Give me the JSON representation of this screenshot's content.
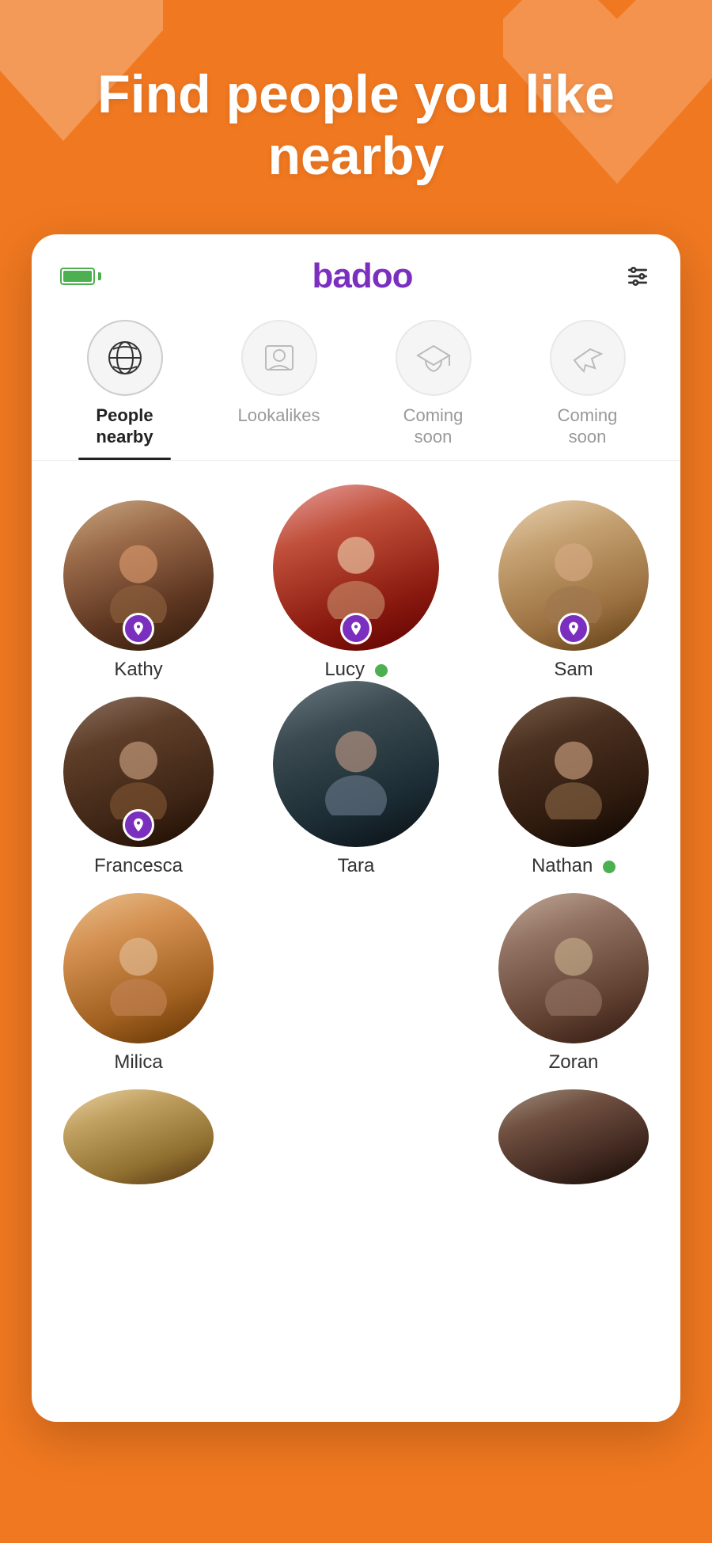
{
  "hero": {
    "title": "Find people you like nearby",
    "background_color": "#F07820"
  },
  "app": {
    "logo": "badoo",
    "accent_color": "#7B2FBE"
  },
  "header": {
    "battery_color": "#4CAF50",
    "filter_label": "filter"
  },
  "tabs": [
    {
      "id": "people-nearby",
      "label": "People\nnearby",
      "icon": "globe-icon",
      "active": true
    },
    {
      "id": "lookalikes",
      "label": "Lookalikes",
      "icon": "photo-icon",
      "active": false
    },
    {
      "id": "coming-soon-1",
      "label": "Coming\nsoon",
      "icon": "graduation-icon",
      "active": false
    },
    {
      "id": "coming-soon-2",
      "label": "Coming\nsoon",
      "icon": "plane-icon",
      "active": false
    }
  ],
  "people": [
    {
      "name": "Kathy",
      "has_pin": true,
      "online": false,
      "size": "large",
      "photo_class": "photo-kathy",
      "col": 0,
      "row": 0
    },
    {
      "name": "Lucy",
      "has_pin": true,
      "online": true,
      "size": "xlarge",
      "photo_class": "photo-lucy",
      "col": 1,
      "row": 0
    },
    {
      "name": "Sam",
      "has_pin": true,
      "online": false,
      "size": "large",
      "photo_class": "photo-sam",
      "col": 2,
      "row": 0
    },
    {
      "name": "Francesca",
      "has_pin": true,
      "online": false,
      "size": "large",
      "photo_class": "photo-francesca",
      "col": 0,
      "row": 1
    },
    {
      "name": "Nathan",
      "has_pin": false,
      "online": false,
      "size": "xlarge",
      "photo_class": "photo-nathan",
      "col": 1,
      "row": 1
    },
    {
      "name": "Tara",
      "has_pin": false,
      "online": true,
      "size": "large",
      "photo_class": "photo-tara",
      "col": 2,
      "row": 1
    },
    {
      "name": "Milica",
      "has_pin": false,
      "online": false,
      "size": "large",
      "photo_class": "photo-milica",
      "col": 0,
      "row": 2
    },
    {
      "name": "Zoran",
      "has_pin": false,
      "online": false,
      "size": "large",
      "photo_class": "photo-zoran",
      "col": 2,
      "row": 2
    }
  ],
  "bottom_partial": [
    {
      "col": 0,
      "photo_class": "photo-bottom1"
    },
    {
      "col": 2,
      "photo_class": "photo-bottom2"
    }
  ]
}
